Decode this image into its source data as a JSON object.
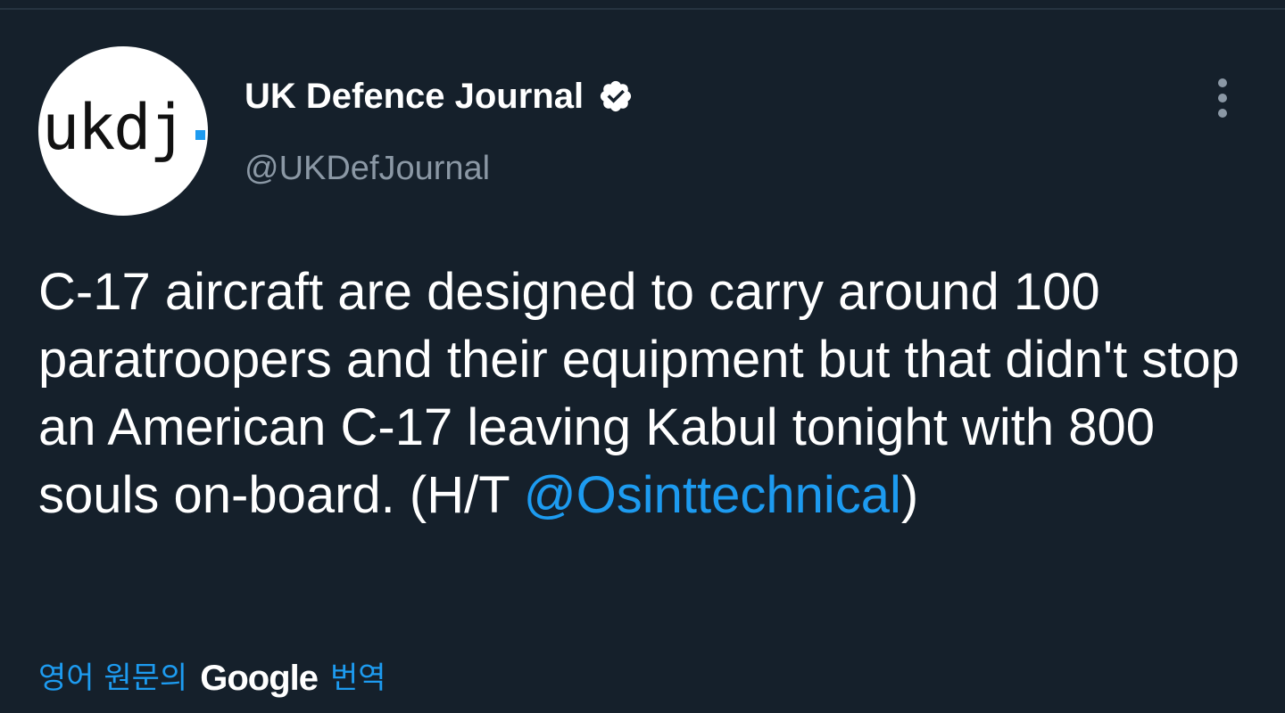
{
  "account": {
    "name": "UK Defence Journal",
    "handle": "@UKDefJournal",
    "avatar_text": "ukdj",
    "verified": true
  },
  "tweet": {
    "text_before": "C-17 aircraft are designed to carry around 100 paratroopers and their equipment but that didn't stop an American C-17 leaving Kabul tonight with 800 souls on-board. (H/T ",
    "mention": "@Osinttechnical",
    "text_after": ")"
  },
  "translate": {
    "prefix": "영어 원문의",
    "brand": "Google",
    "suffix": "번역"
  },
  "icons": {
    "verified": "verified-badge-icon",
    "more": "more-options-icon"
  },
  "colors": {
    "background": "#15202b",
    "accent": "#1d9bf0",
    "secondary_text": "#8b98a5"
  }
}
